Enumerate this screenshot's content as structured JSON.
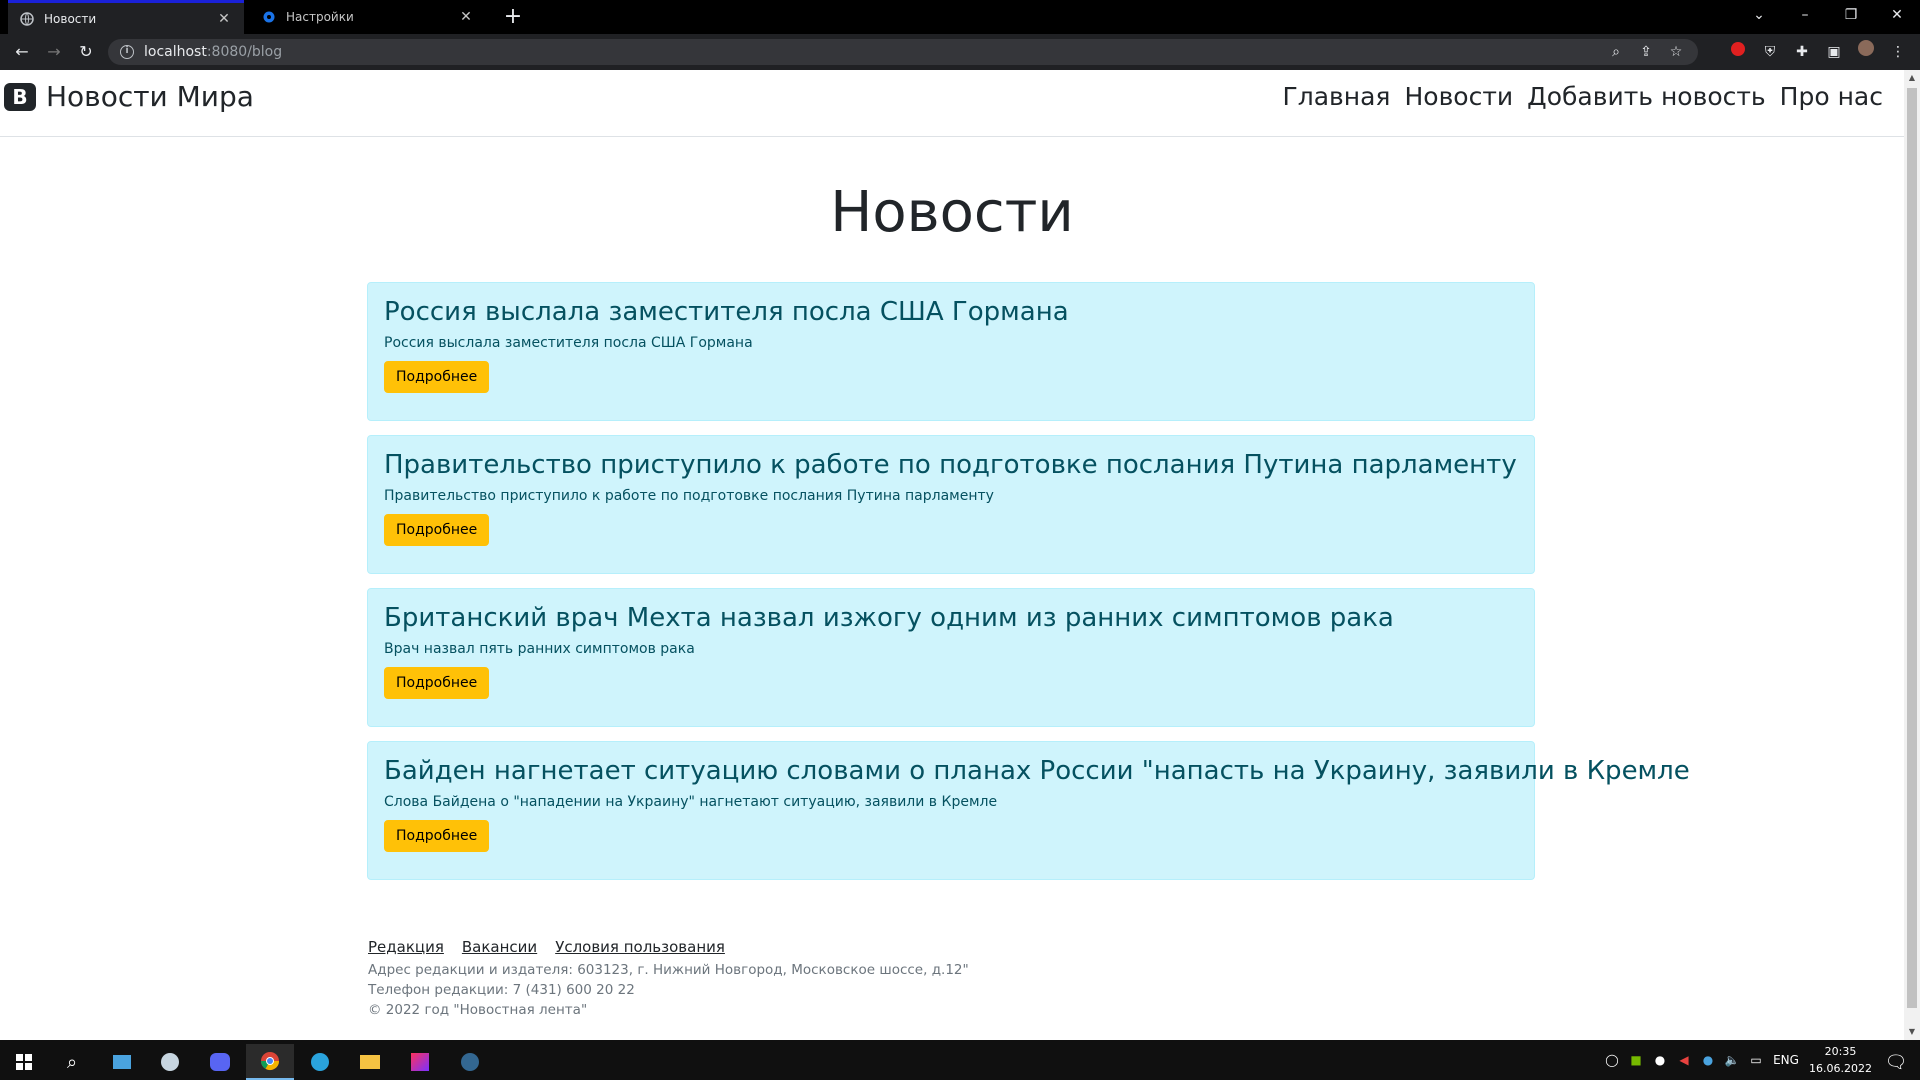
{
  "browser": {
    "tabs": [
      {
        "title": "Новости",
        "active": true
      },
      {
        "title": "Настройки",
        "active": false
      }
    ],
    "new_tab": "+",
    "url_host": "localhost",
    "url_path": ":8080/blog",
    "controls": {
      "minimize": "–",
      "restore": "❐",
      "close": "✕",
      "tab_search": "⌄"
    }
  },
  "site": {
    "brand_letter": "B",
    "brand_name": "Новости Мира",
    "nav": [
      "Главная",
      "Новости",
      "Добавить новость",
      "Про нас"
    ],
    "page_title": "Новости",
    "news": [
      {
        "title": "Россия выслала заместителя посла США Гормана",
        "summary": "Россия выслала заместителя посла США Гормана",
        "button": "Подробнее"
      },
      {
        "title": "Правительство приступило к работе по подготовке послания Путина парламенту",
        "summary": "Правительство приступило к работе по подготовке послания Путина парламенту",
        "button": "Подробнее"
      },
      {
        "title": "Британский врач Мехта назвал изжогу одним из ранних симптомов рака",
        "summary": "Врач назвал пять ранних симптомов рака",
        "button": "Подробнее"
      },
      {
        "title": "Байден нагнетает ситуацию словами о планах России \"напасть на Украину, заявили в Кремле",
        "summary": "Слова Байдена о \"нападении на Украину\" нагнетают ситуацию, заявили в Кремле",
        "button": "Подробнее"
      }
    ],
    "footer": {
      "links": [
        "Редакция",
        "Вакансии",
        "Условия пользования"
      ],
      "address": "Адрес редакции и издателя: 603123, г. Нижний Новгород, Московское шоссе, д.12\"",
      "phone": "Телефон редакции: 7 (431) 600 20 22",
      "copyright": "© 2022 год \"Новостная лента\""
    }
  },
  "taskbar": {
    "language": "ENG",
    "time": "20:35",
    "date": "16.06.2022"
  },
  "colors": {
    "card_bg": "#cff4fc",
    "card_text": "#055160",
    "button_bg": "#ffc107",
    "active_tab_accent": "#1a21d8"
  }
}
